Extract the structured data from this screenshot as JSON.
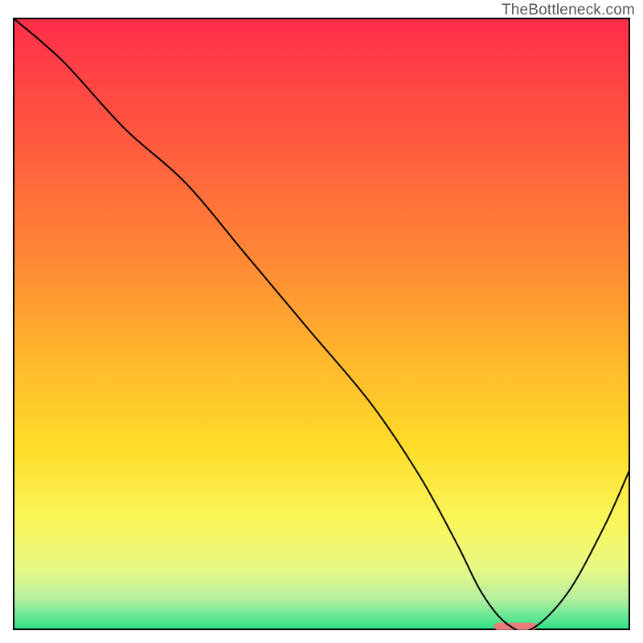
{
  "watermark": "TheBottleneck.com",
  "chart_data": {
    "type": "line",
    "title": "",
    "xlabel": "",
    "ylabel": "",
    "xlim": [
      0,
      100
    ],
    "ylim": [
      0,
      100
    ],
    "background": {
      "gradient_stops": [
        {
          "pos": 0.0,
          "color": "#ff2e4a"
        },
        {
          "pos": 0.2,
          "color": "#ff5a3f"
        },
        {
          "pos": 0.4,
          "color": "#ff8a35"
        },
        {
          "pos": 0.55,
          "color": "#ffb52c"
        },
        {
          "pos": 0.7,
          "color": "#ffdc2a"
        },
        {
          "pos": 0.82,
          "color": "#faf65a"
        },
        {
          "pos": 0.9,
          "color": "#e9f884"
        },
        {
          "pos": 0.95,
          "color": "#b5f0a0"
        },
        {
          "pos": 1.0,
          "color": "#2ee08a"
        }
      ]
    },
    "series": [
      {
        "name": "bottleneck-curve",
        "stroke": "#000000",
        "stroke_width": 2,
        "x": [
          0,
          8,
          18,
          28,
          38,
          48,
          58,
          66,
          72,
          76,
          80,
          84,
          90,
          96,
          100
        ],
        "y": [
          100,
          93,
          82,
          73,
          61,
          49,
          37,
          25,
          14,
          6,
          1,
          0,
          6,
          17,
          26
        ]
      }
    ],
    "marker": {
      "name": "optimal-range",
      "x_start": 78,
      "x_end": 85,
      "color": "#e97b7b",
      "y": 0.5,
      "thickness": 9
    },
    "frame": {
      "color": "#000000",
      "width": 2
    }
  }
}
